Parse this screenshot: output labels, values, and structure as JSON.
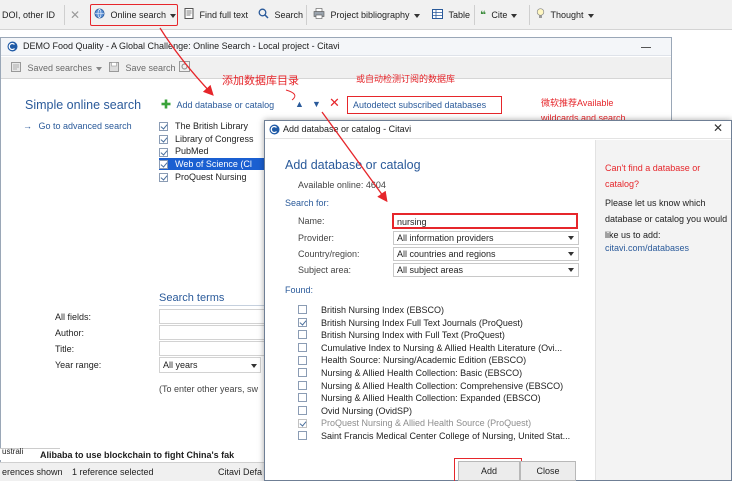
{
  "toolbar": {
    "doi_label": "DOI, other ID",
    "online_search": "Online search",
    "find_full_text": "Find full text",
    "search": "Search",
    "project_bibliography": "Project bibliography",
    "table": "Table",
    "cite": "Cite",
    "thought": "Thought"
  },
  "bg_window": {
    "title": "DEMO Food Quality - A Global Challenge: Online Search - Local project - Citavi",
    "saved_searches": "Saved searches",
    "save_search": "Save search",
    "simple_title": "Simple online search",
    "advanced_link": "Go to advanced search",
    "add_database": "Add database or catalog",
    "autodetect": "Autodetect subscribed databases",
    "databases": [
      {
        "label": "The British Library",
        "checked": true,
        "selected": false
      },
      {
        "label": "Library of Congress",
        "checked": true,
        "selected": false
      },
      {
        "label": "PubMed",
        "checked": true,
        "selected": false
      },
      {
        "label": "Web of Science (Cl",
        "checked": true,
        "selected": true
      },
      {
        "label": "ProQuest Nursing",
        "checked": true,
        "selected": false
      }
    ],
    "search_terms": "Search terms",
    "fields": {
      "all_fields": "All fields:",
      "author": "Author:",
      "title": "Title:",
      "year_range": "Year range:"
    },
    "year_value": "All years",
    "hint": "(To enter other years, sw",
    "left_strip": "ustrali",
    "news_row": "Alibaba to use blockchain to fight China's fak"
  },
  "statusbar": {
    "references_shown": "erences shown",
    "selected": "1 reference selected",
    "citavi": "Citavi Defa"
  },
  "annotations": {
    "add_db_note": "添加数据库目录",
    "auto_note": "或自动检测订阅的数据库",
    "right_note_1": "微软推荐Available",
    "right_note_2": "wildcards and search"
  },
  "dialog": {
    "title": "Add database or catalog - Citavi",
    "close": "✕",
    "heading": "Add database or catalog",
    "available": "Available online: 4604",
    "search_for": "Search for:",
    "name_label": "Name:",
    "name_value": "nursing",
    "provider_label": "Provider:",
    "provider_value": "All information providers",
    "country_label": "Country/region:",
    "country_value": "All countries and regions",
    "subject_label": "Subject area:",
    "subject_value": "All subject areas",
    "found_label": "Found:",
    "found": [
      {
        "label": "British Nursing Index (EBSCO)",
        "checked": false,
        "disabled": false
      },
      {
        "label": "British Nursing Index Full Text Journals (ProQuest)",
        "checked": true,
        "disabled": false
      },
      {
        "label": "British Nursing Index with Full Text (ProQuest)",
        "checked": false,
        "disabled": false
      },
      {
        "label": "Cumulative Index to Nursing & Allied Health Literature (Ovi...",
        "checked": false,
        "disabled": false
      },
      {
        "label": "Health Source: Nursing/Academic Edition (EBSCO)",
        "checked": false,
        "disabled": false
      },
      {
        "label": "Nursing & Allied Health Collection: Basic (EBSCO)",
        "checked": false,
        "disabled": false
      },
      {
        "label": "Nursing & Allied Health Collection: Comprehensive (EBSCO)",
        "checked": false,
        "disabled": false
      },
      {
        "label": "Nursing & Allied Health Collection: Expanded (EBSCO)",
        "checked": false,
        "disabled": false
      },
      {
        "label": "Ovid Nursing (OvidSP)",
        "checked": false,
        "disabled": false
      },
      {
        "label": "ProQuest Nursing & Allied Health Source (ProQuest)",
        "checked": true,
        "disabled": true
      },
      {
        "label": "Saint Francis Medical Center College of Nursing, United Stat...",
        "checked": false,
        "disabled": false
      }
    ],
    "add_button": "Add",
    "close_button": "Close",
    "cant_find": "Can't find a database or catalog?",
    "let_us_know": "Please let us know which database or catalog you would like us to add:",
    "link": "citavi.com/databases"
  },
  "colors": {
    "accent_blue": "#2a5a9a",
    "annotation_red": "#e6262b",
    "selection_blue": "#1a5fd1"
  }
}
